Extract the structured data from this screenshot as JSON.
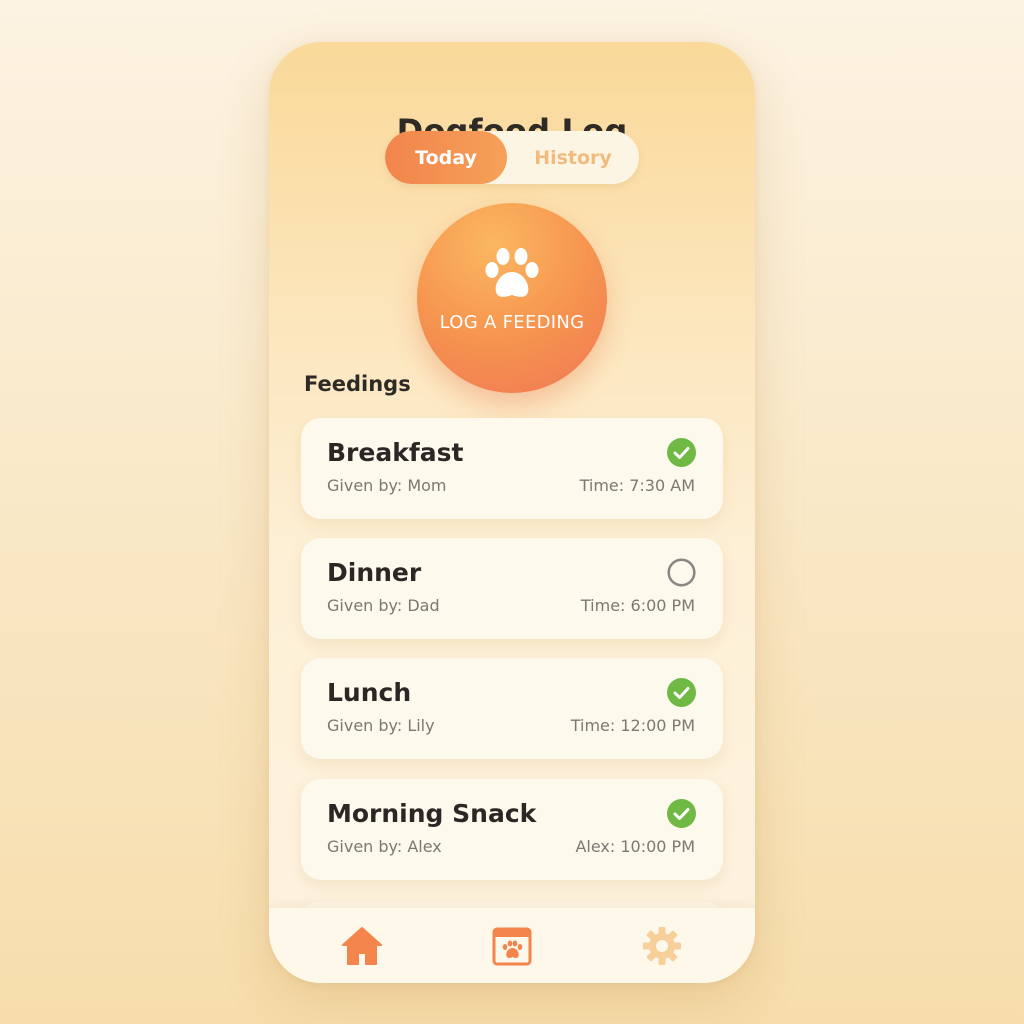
{
  "app": {
    "title": "Dogfood Log"
  },
  "tabs": {
    "today": "Today",
    "history": "History"
  },
  "log_button": {
    "label": "LOG A FEEDING"
  },
  "section": {
    "feedings_label": "Feedings"
  },
  "feedings": [
    {
      "meal": "Breakfast",
      "given": "Given by: Mom",
      "time": "Time: 7:30 AM",
      "done": true
    },
    {
      "meal": "Dinner",
      "given": "Given by: Dad",
      "time": "Time: 6:00 PM",
      "done": false
    },
    {
      "meal": "Lunch",
      "given": "Given by: Lily",
      "time": "Time: 12:00 PM",
      "done": true
    },
    {
      "meal": "Morning Snack",
      "given": "Given by: Alex",
      "time": "Alex: 10:00 PM",
      "done": true
    }
  ],
  "nav": {
    "icons": [
      "home-icon",
      "calendar-paw-icon",
      "gear-icon"
    ]
  },
  "colors": {
    "accent_orange": "#f2844c",
    "check_green": "#6fb944",
    "inactive_tab": "#f1bb7e",
    "gear": "#f6cf9a"
  }
}
